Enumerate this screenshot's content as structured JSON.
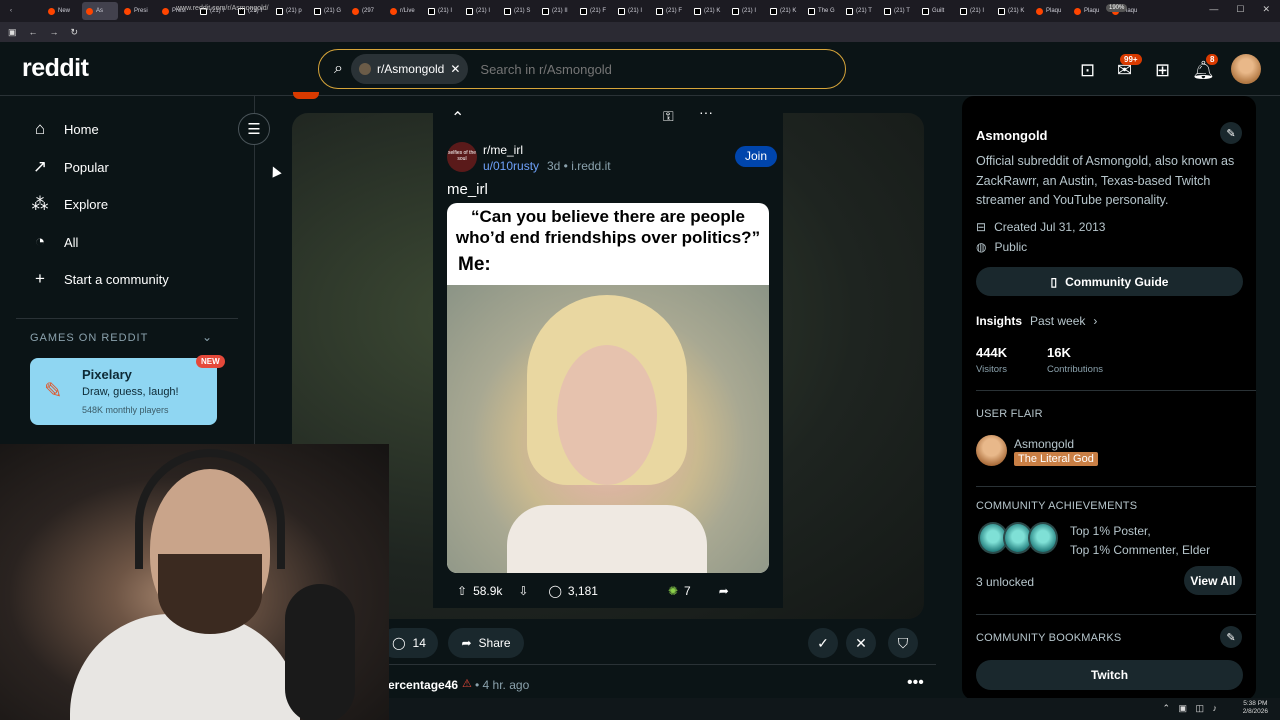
{
  "browser": {
    "tabs": [
      {
        "label": "",
        "type": "nav"
      },
      {
        "label": "New",
        "type": "reddit"
      },
      {
        "label": "As",
        "type": "reddit",
        "active": true
      },
      {
        "label": "Presi",
        "type": "reddit"
      },
      {
        "label": "Presi",
        "type": "reddit"
      },
      {
        "label": "(21) I",
        "type": "x"
      },
      {
        "label": "(21) I",
        "type": "x"
      },
      {
        "label": "(21) p",
        "type": "x"
      },
      {
        "label": "(21) G",
        "type": "x"
      },
      {
        "label": "(297",
        "type": "reddit"
      },
      {
        "label": "r/Live",
        "type": "reddit"
      },
      {
        "label": "(21) I",
        "type": "x"
      },
      {
        "label": "(21) I",
        "type": "x"
      },
      {
        "label": "(21) S",
        "type": "x"
      },
      {
        "label": "(21) II",
        "type": "x"
      },
      {
        "label": "(21) F",
        "type": "x"
      },
      {
        "label": "(21) I",
        "type": "x"
      },
      {
        "label": "(21) F",
        "type": "x"
      },
      {
        "label": "(21) K",
        "type": "x"
      },
      {
        "label": "(21) I",
        "type": "x"
      },
      {
        "label": "(21) K",
        "type": "x"
      },
      {
        "label": "The G",
        "type": "x"
      },
      {
        "label": "(21) T",
        "type": "x"
      },
      {
        "label": "(21) T",
        "type": "x"
      },
      {
        "label": "Guilt",
        "type": "x"
      },
      {
        "label": "(21) I",
        "type": "x"
      },
      {
        "label": "(21) K",
        "type": "x"
      },
      {
        "label": "Plaqu",
        "type": "reddit"
      },
      {
        "label": "Plaqu",
        "type": "reddit"
      },
      {
        "label": "Plaqu",
        "type": "reddit"
      }
    ],
    "url": "www.reddit.com/r/Asmongold/",
    "zoom": "190%"
  },
  "header": {
    "logo": "reddit",
    "search_chip": "r/Asmongold",
    "search_placeholder": "Search in r/Asmongold",
    "chat_badge": "99+",
    "notif_badge": "8"
  },
  "left_nav": {
    "items": [
      {
        "label": "Home",
        "icon": "home-icon"
      },
      {
        "label": "Popular",
        "icon": "popular-icon"
      },
      {
        "label": "Explore",
        "icon": "explore-icon"
      },
      {
        "label": "All",
        "icon": "all-icon"
      },
      {
        "label": "Start a community",
        "icon": "plus-icon"
      }
    ],
    "games_heading": "GAMES ON REDDIT",
    "game_card": {
      "title": "Pixelary",
      "subtitle": "Draw, guess, laugh!",
      "players": "548K monthly players",
      "badge": "NEW"
    }
  },
  "post": {
    "subreddit": "r/me_irl",
    "sub_icon_text": "selfies of the soul",
    "user": "u/010rusty",
    "meta": "3d • i.redd.it",
    "join": "Join",
    "title": "me_irl",
    "meme_caption": "“Can you believe there are people who’d end friendships over politics?”",
    "meme_me": "Me:",
    "upvotes": "58.9k",
    "comments": "3,181",
    "awards": "7"
  },
  "feed_actions": {
    "comments": "14",
    "share": "Share"
  },
  "next_post": {
    "user": "ercentage46",
    "meta": "• 4 hr. ago"
  },
  "right_sidebar": {
    "title": "Asmongold",
    "description": "Official subreddit of Asmongold, also known as ZackRawrr, an Austin, Texas-based Twitch streamer and YouTube personality.",
    "created": "Created Jul 31, 2013",
    "visibility": "Public",
    "guide_button": "Community Guide",
    "insights_label": "Insights",
    "insights_range": "Past week",
    "visitors_num": "444K",
    "visitors_label": "Visitors",
    "contrib_num": "16K",
    "contrib_label": "Contributions",
    "user_flair_heading": "USER FLAIR",
    "flair_name": "Asmongold",
    "flair_tag": "The Literal God",
    "achievements_heading": "COMMUNITY ACHIEVEMENTS",
    "achievement_line1": "Top 1% Poster,",
    "achievement_line2": "Top 1% Commenter, Elder",
    "unlocked": "3 unlocked",
    "view_all": "View All",
    "bookmarks_heading": "COMMUNITY BOOKMARKS",
    "bookmark_twitch": "Twitch"
  },
  "taskbar": {
    "time": "5:38 PM",
    "date": "2/8/2026"
  }
}
